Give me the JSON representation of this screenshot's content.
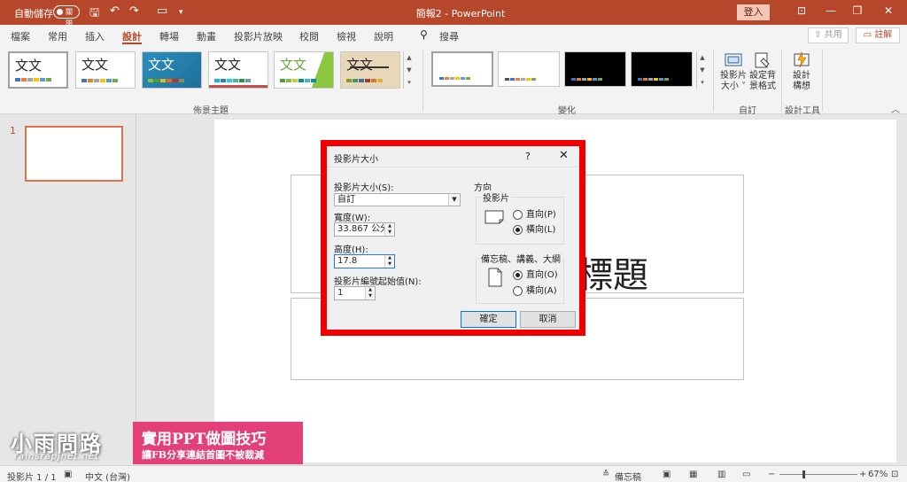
{
  "titlebar": {
    "autosave_label": "自動儲存",
    "autosave_state": "關閉",
    "doc_title": "簡報2  -  PowerPoint",
    "signin_label": "登入",
    "qa_icons": [
      "save-icon",
      "undo-icon",
      "redo-icon",
      "present-icon",
      "customize-icon"
    ]
  },
  "menu": {
    "tabs": [
      "檔案",
      "常用",
      "插入",
      "設計",
      "轉場",
      "動畫",
      "投影片放映",
      "校閱",
      "檢視",
      "說明"
    ],
    "active_tab": "設計",
    "search_label": "搜尋",
    "share_label": "共用",
    "comment_label": "註解"
  },
  "ribbon": {
    "theme_sample_text": "文文",
    "themes_group_label": "佈景主題",
    "variants_group_label": "變化",
    "customize_group_label": "自訂",
    "designer_group_label": "設計工具",
    "slide_size_label_1": "投影片",
    "slide_size_label_2": "大小 ˅",
    "format_bg_label_1": "設定背",
    "format_bg_label_2": "景格式",
    "design_ideas_label_1": "設計",
    "design_ideas_label_2": "構想"
  },
  "thumbnails": {
    "number": "1"
  },
  "slide": {
    "title_fragment": "標題"
  },
  "dialog": {
    "title": "投影片大小",
    "help": "?",
    "size_label": "投影片大小(S):",
    "size_value": "自訂",
    "width_label": "寬度(W):",
    "width_value": "33.867 公分",
    "height_label": "高度(H):",
    "height_value": "17.8",
    "number_label": "投影片編號起始值(N):",
    "number_value": "1",
    "orientation_label": "方向",
    "slides_label": "投影片",
    "slides_portrait": "直向(P)",
    "slides_landscape": "橫向(L)",
    "notes_label": "備忘稿、講義、大綱",
    "notes_portrait": "直向(O)",
    "notes_landscape": "橫向(A)",
    "ok_label": "確定",
    "cancel_label": "取消"
  },
  "watermark": {
    "site_name": "小雨問路",
    "site_url": "rainsrapjnet.net",
    "banner_line1": "實用PPT做圖技巧",
    "banner_line2": "讓FB分享連結首圖不被裁減"
  },
  "status": {
    "slide_info": "投影片 1 / 1",
    "language": "中文 (台灣)",
    "notes_label": "備忘稿",
    "zoom": "67%"
  },
  "colors": {
    "accent": "#b7472a",
    "highlight_frame": "#f20000",
    "banner": "#e33f78"
  }
}
